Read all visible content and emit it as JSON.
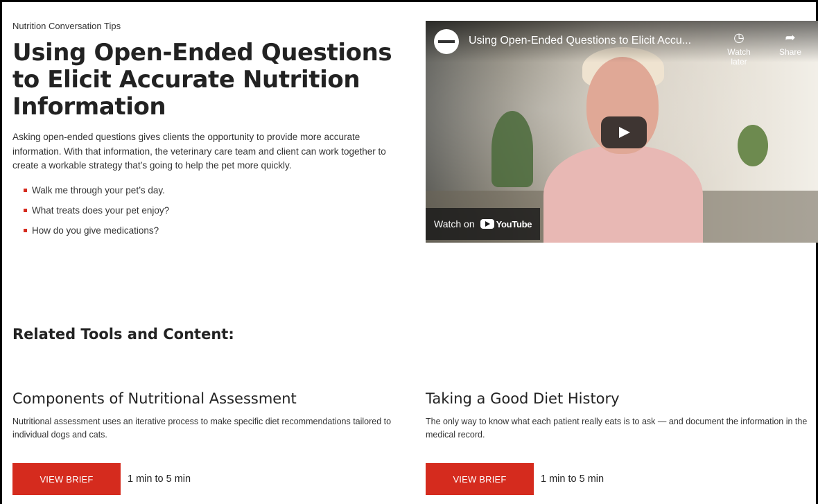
{
  "article": {
    "eyebrow": "Nutrition Conversation Tips",
    "title": "Using Open-Ended Questions to Elicit Accurate Nutrition Information",
    "lead": "Asking open-ended questions gives clients the opportunity to provide more accurate information. With that information, the veterinary care team and client can work together to create a workable strategy that’s going to help the pet more quickly.",
    "bullets": [
      "Walk me through your pet’s day.",
      "What treats does your pet enjoy?",
      "How do you give medications?"
    ]
  },
  "video": {
    "title": "Using Open-Ended Questions to Elicit Accu...",
    "watch_later": "Watch later",
    "share": "Share",
    "watch_on": "Watch on",
    "youtube": "YouTube",
    "accent": "#d52b1e"
  },
  "related": {
    "heading": "Related Tools and Content:",
    "cards": [
      {
        "title": "Components of Nutritional Assessment",
        "description": "Nutritional assessment uses an iterative process to make specific diet recommendations tailored to individual dogs and cats.",
        "button": "VIEW BRIEF",
        "duration": "1 min to 5 min"
      },
      {
        "title": "Taking a Good Diet History",
        "description": "The only way to know what each patient really eats is to ask — and document the information in the medical record.",
        "button": "VIEW BRIEF",
        "duration": "1 min to 5 min"
      }
    ]
  }
}
